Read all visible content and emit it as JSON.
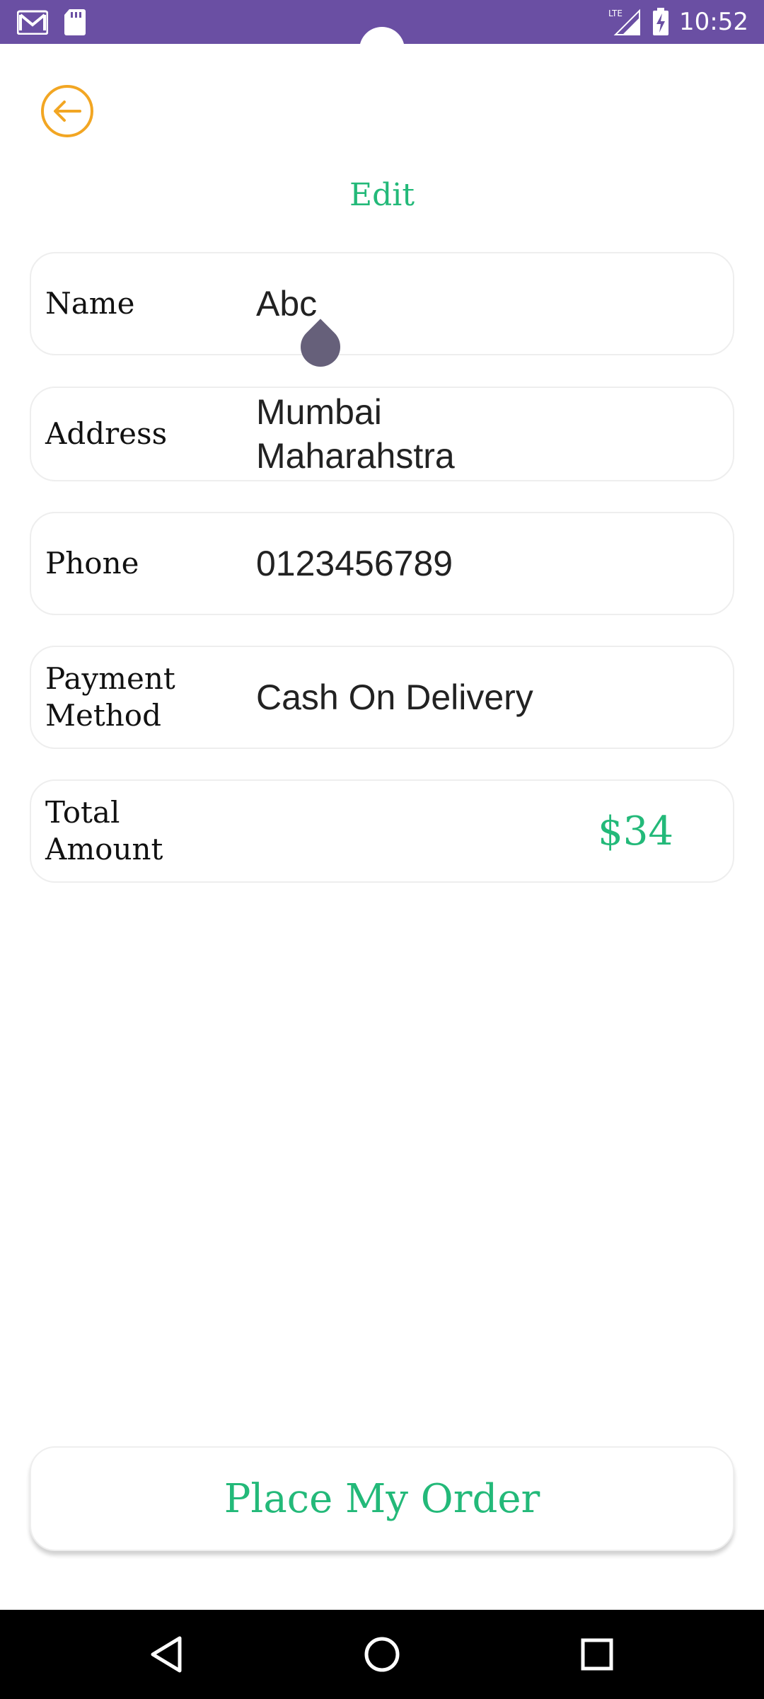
{
  "status_bar": {
    "time": "10:52",
    "network": "LTE",
    "icons": [
      "gmail-icon",
      "sd-card-icon",
      "lte-signal-icon",
      "battery-charging-icon"
    ]
  },
  "header": {
    "back_icon": "arrow-left-circle-icon",
    "edit_label": "Edit"
  },
  "rows": [
    {
      "label": "Name",
      "value": "Abc"
    },
    {
      "label": "Address",
      "value_lines": [
        "Mumbai",
        "Maharahstra"
      ]
    },
    {
      "label": "Phone",
      "value": "0123456789"
    },
    {
      "label_lines": [
        "Payment",
        "Method"
      ],
      "value": "Cash On Delivery"
    },
    {
      "label_lines": [
        "Total",
        "Amount"
      ],
      "amount": "$34"
    }
  ],
  "actions": {
    "place_order_label": "Place My Order"
  },
  "colors": {
    "status_bar": "#6a4fa3",
    "accent_green": "#23b979",
    "back_orange": "#f2a623"
  }
}
